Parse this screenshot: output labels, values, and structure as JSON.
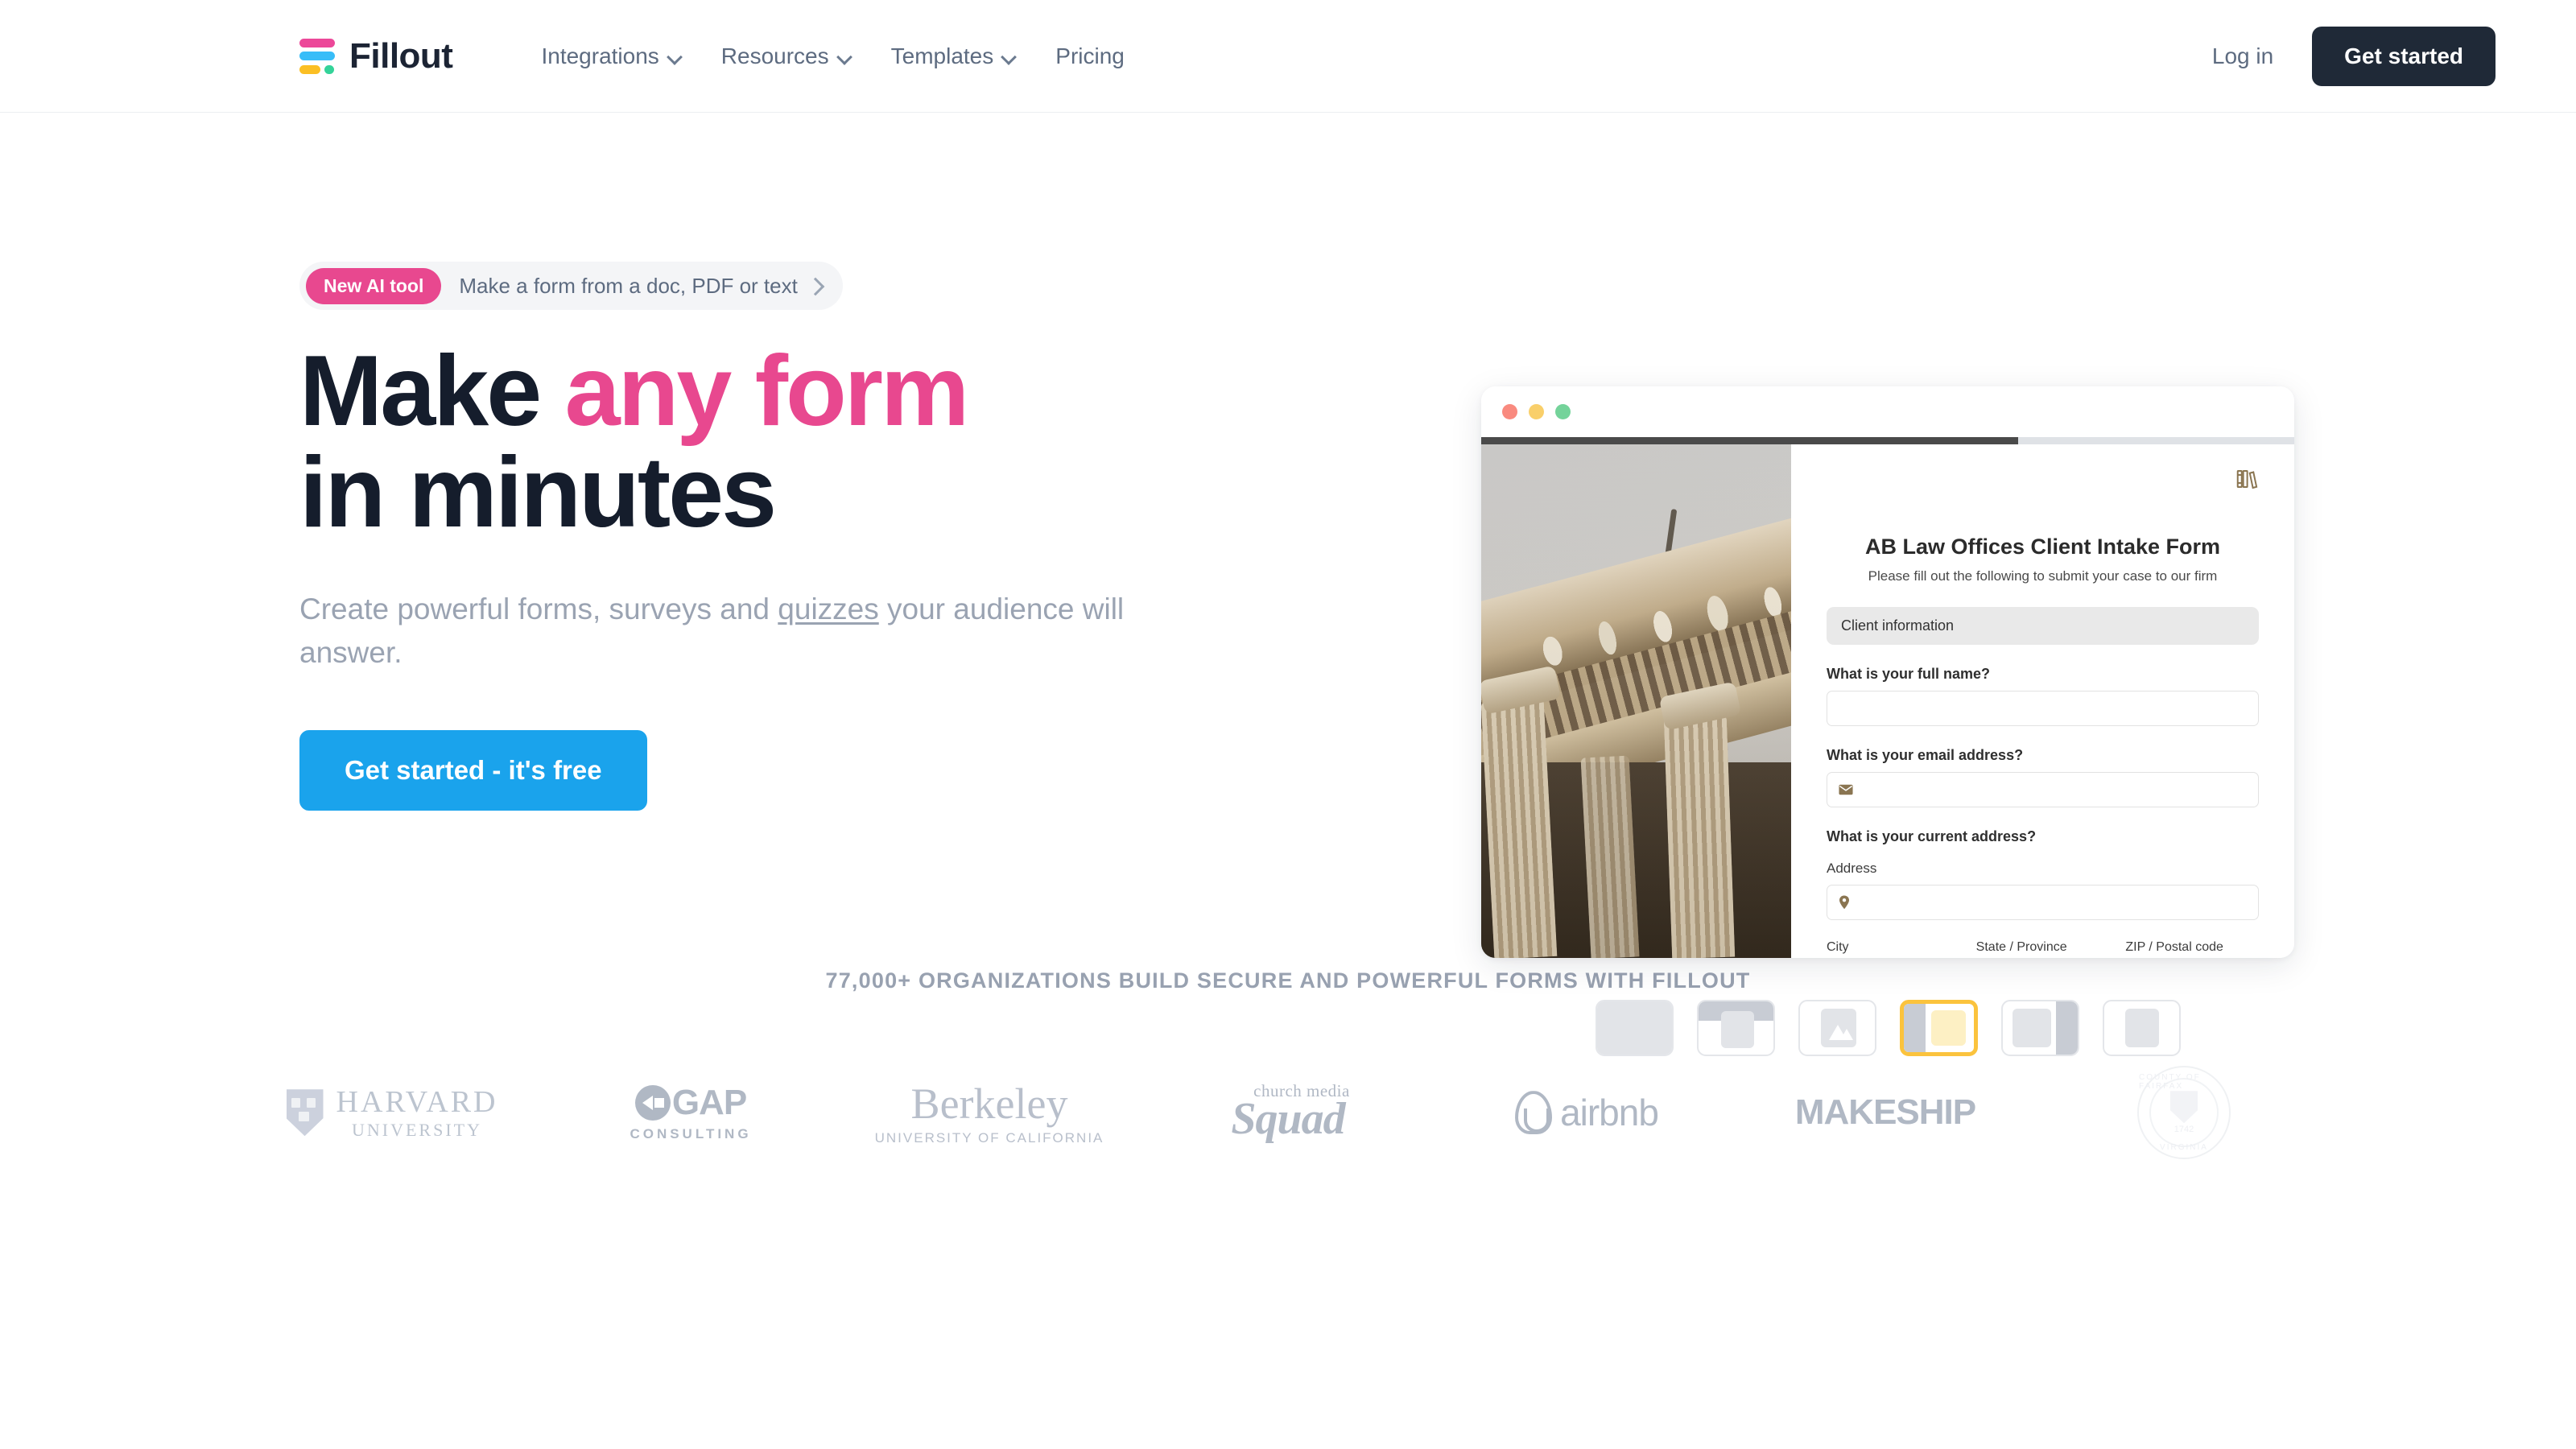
{
  "header": {
    "brand_name": "Fillout",
    "logo_colors": {
      "pink": "#ec4899",
      "blue": "#38bdf8",
      "yellow": "#fbbf24",
      "green": "#34d399"
    },
    "nav": [
      {
        "label": "Integrations",
        "has_dropdown": true
      },
      {
        "label": "Resources",
        "has_dropdown": true
      },
      {
        "label": "Templates",
        "has_dropdown": true
      },
      {
        "label": "Pricing",
        "has_dropdown": false
      }
    ],
    "login_label": "Log in",
    "cta_label": "Get started"
  },
  "hero": {
    "badge_tag": "New AI tool",
    "badge_text": "Make a form from a doc, PDF or text",
    "headline_part1": "Make ",
    "headline_accent": "any form",
    "headline_part2": "in minutes",
    "subhead_pre": "Create powerful forms, surveys and ",
    "subhead_link": "quizzes",
    "subhead_post": " your audience will answer.",
    "cta_label": "Get started - it's free",
    "accent_color": "#e8488f",
    "cta_color": "#1aa3ec"
  },
  "preview": {
    "traffic_lights": [
      "red",
      "yellow",
      "green"
    ],
    "progress_percent": 66,
    "books_icon": "books-icon",
    "form_title": "AB Law Offices Client Intake Form",
    "form_subtitle": "Please fill out the following to submit your case to our firm",
    "section_label": "Client information",
    "fields": [
      {
        "label": "What is your full name?",
        "type": "text",
        "value": "",
        "icon": null
      },
      {
        "label": "What is your email address?",
        "type": "email",
        "value": "",
        "icon": "envelope-icon"
      },
      {
        "label": "What is your current address?",
        "type": "address",
        "value": "",
        "icon": null
      }
    ],
    "address_label": "Address",
    "address_icon": "map-pin-icon",
    "address_sub": [
      {
        "label": "City",
        "type": "text",
        "value": ""
      },
      {
        "label": "State / Province",
        "type": "select",
        "value": ""
      },
      {
        "label": "ZIP / Postal code",
        "type": "text",
        "value": ""
      }
    ]
  },
  "layout_picker": {
    "selected_index": 3,
    "selected_color": "#fbc33d",
    "thumbs": [
      {
        "name": "layout-full-bleed"
      },
      {
        "name": "layout-top-banner"
      },
      {
        "name": "layout-image-center"
      },
      {
        "name": "layout-left-split"
      },
      {
        "name": "layout-right-split"
      },
      {
        "name": "layout-plain-card"
      }
    ]
  },
  "social_proof": {
    "headline": "77,000+ ORGANIZATIONS BUILD SECURE AND POWERFUL FORMS WITH FILLOUT",
    "logos": [
      {
        "name": "harvard-university",
        "line1": "HARVARD",
        "line2": "UNIVERSITY"
      },
      {
        "name": "gap-consulting",
        "line1": "GAP",
        "line2": "CONSULTING"
      },
      {
        "name": "uc-berkeley",
        "line1": "Berkeley",
        "line2": "UNIVERSITY OF CALIFORNIA"
      },
      {
        "name": "church-media-squad",
        "line1": "church media",
        "line2": "Squad"
      },
      {
        "name": "airbnb",
        "line1": "airbnb",
        "line2": ""
      },
      {
        "name": "makeship",
        "line1": "MAKESHIP",
        "line2": ""
      },
      {
        "name": "county-of-fairfax-virginia",
        "line1": "COUNTY OF FAIRFAX",
        "line2": "VIRGINIA",
        "year": "1742"
      }
    ]
  }
}
